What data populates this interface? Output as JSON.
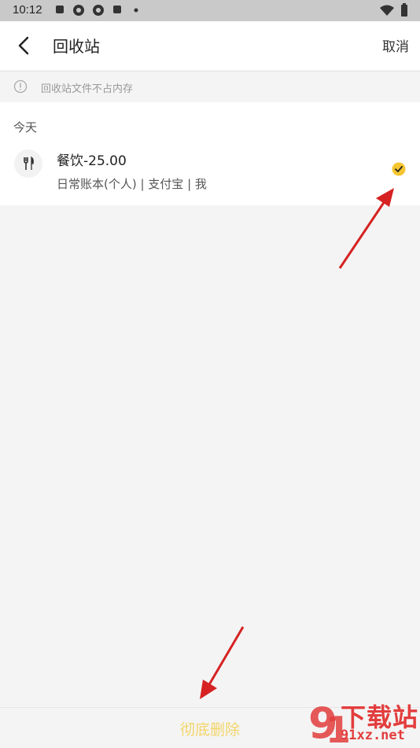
{
  "status_bar": {
    "time": "10:12"
  },
  "header": {
    "title": "回收站",
    "cancel_label": "取消"
  },
  "notice": {
    "text": "回收站文件不占内存"
  },
  "records": {
    "date_label": "今天",
    "items": [
      {
        "amount_text": "餐饮-25.00",
        "meta_text": "日常账本(个人) | 支付宝 | 我",
        "category_icon": "fork-knife-icon",
        "selected": true
      }
    ]
  },
  "bottom": {
    "delete_label": "彻底删除"
  },
  "watermark": {
    "text": "下载站",
    "url": "91xz.net"
  },
  "colors": {
    "accent": "#f3d568",
    "check": "#f5c531",
    "annotation_arrow": "#d62222",
    "watermark": "#e33d3d"
  }
}
